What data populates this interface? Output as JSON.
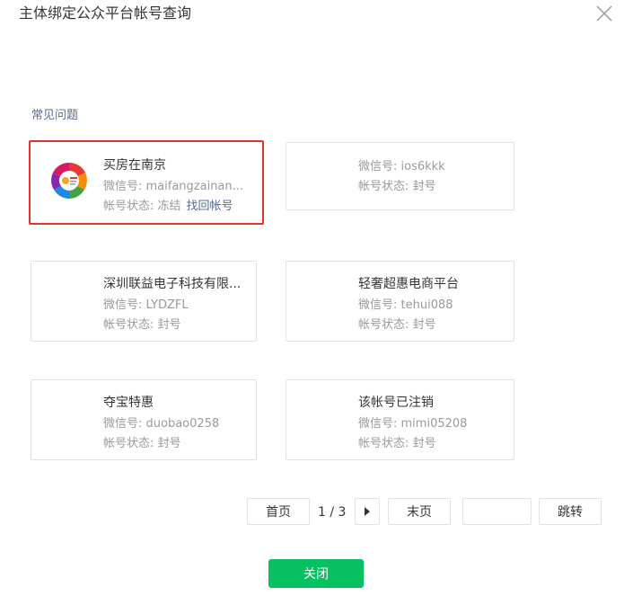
{
  "dialog": {
    "title": "主体绑定公众平台帐号查询",
    "faq_link": "常见问题"
  },
  "accounts": [
    {
      "name": "买房在南京",
      "wechat_id": "微信号: maifangzainan...",
      "status_label": "帐号状态: 冻结",
      "recover_link": "找回帐号",
      "has_avatar": true
    },
    {
      "name": "",
      "wechat_id": "微信号: ios6kkk",
      "status_label": "帐号状态: 封号"
    },
    {
      "name": "深圳联益电子科技有限...",
      "wechat_id": "微信号: LYDZFL",
      "status_label": "帐号状态: 封号"
    },
    {
      "name": "轻奢超惠电商平台",
      "wechat_id": "微信号: tehui088",
      "status_label": "帐号状态: 封号"
    },
    {
      "name": "夺宝特惠",
      "wechat_id": "微信号: duobao0258",
      "status_label": "帐号状态: 封号"
    },
    {
      "name": "该帐号已注销",
      "wechat_id": "微信号: mimi05208",
      "status_label": "帐号状态: 封号"
    }
  ],
  "pagination": {
    "first_label": "首页",
    "indicator": "1 / 3",
    "last_label": "末页",
    "jump_input_value": "",
    "jump_label": "跳转"
  },
  "footer": {
    "close_label": "关闭"
  },
  "colors": {
    "primary": "#07c160",
    "link": "#576b95",
    "highlight_border": "#e5322d",
    "card_border": "#e2e2e2",
    "muted_text": "#9a9a9a"
  },
  "icons": {
    "close": "close-icon",
    "next_page": "caret-right-icon"
  }
}
